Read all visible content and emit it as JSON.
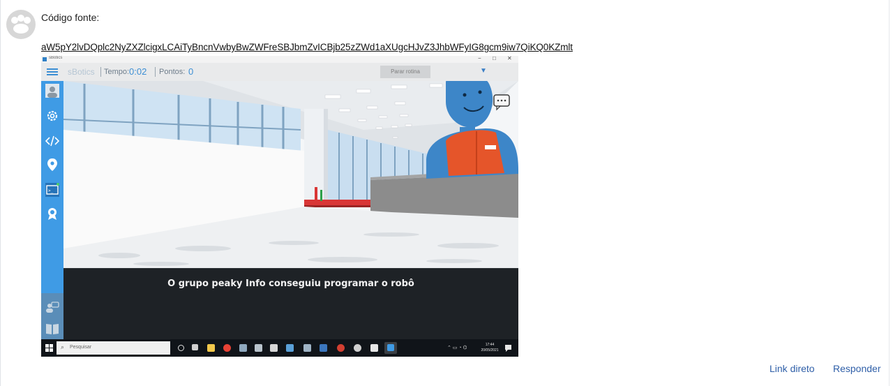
{
  "post": {
    "label": "Código fonte:",
    "code_link": "aW5pY2lvDQplc2NyZXZlcigxLCAiTyBncnVwbyBwZWFreSBJbmZvICBjb25zZWd1aXUgcHJvZ3JhbWFyIG8gcm9iw7QiKQ0KZmlt"
  },
  "screenshot": {
    "app_title": "sBotics",
    "window_controls": [
      "−",
      "□",
      "✕"
    ],
    "brand": "sBotics",
    "time_label": "Tempo:",
    "time_value": "0:02",
    "points_label": "Pontos:",
    "points_value": "0",
    "stop_button": "Parar rotina",
    "dropdown_arrow": "▼",
    "caption": "O grupo peaky Info  conseguiu programar o robô",
    "taskbar": {
      "search_placeholder": "Pesquisar",
      "clock_time": "17:44",
      "clock_date": "20/05/2021"
    }
  },
  "actions": {
    "direct_link": "Link direto",
    "reply": "Responder"
  },
  "icons": [
    "avatar-placeholder-icon",
    "hamburger-menu-icon",
    "user-icon",
    "settings-icon",
    "code-icon",
    "location-pin-icon",
    "terminal-icon",
    "award-icon",
    "chat-icon",
    "book-icon",
    "speech-bubble-icon",
    "windows-start-icon",
    "search-icon"
  ],
  "colors": {
    "link": "#2f5fa8",
    "sbotics_blue": "#3f9be5",
    "robot_orange": "#e5552a",
    "robot_blue": "#3d86c8"
  }
}
